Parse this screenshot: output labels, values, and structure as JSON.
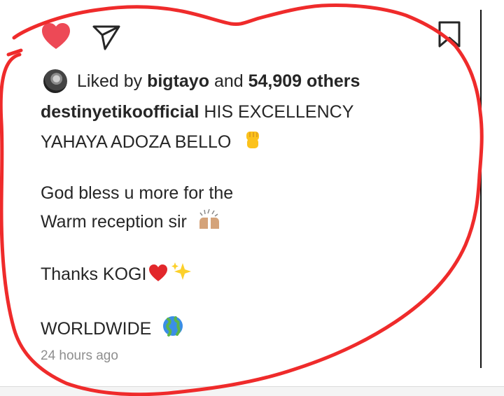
{
  "actions": {
    "like_icon": "heart-filled-icon",
    "share_icon": "paper-plane-icon",
    "save_icon": "bookmark-icon",
    "like_color": "#ed4956"
  },
  "likes": {
    "prefix": "Liked by",
    "user": "bigtayo",
    "and": "and",
    "count": "54,909 others"
  },
  "caption": {
    "username": "destinyetikoofficial",
    "line1_text": "HIS EXCELLENCY",
    "line2_text": "YAHAYA ADOZA BELLO",
    "line3_text": "God bless u more for the",
    "line4_text": "Warm reception sir",
    "line5_text": "Thanks KOGI",
    "line6_text": "WORLDWIDE"
  },
  "timestamp": "24 hours ago",
  "annotation_color": "#ef2b2b"
}
